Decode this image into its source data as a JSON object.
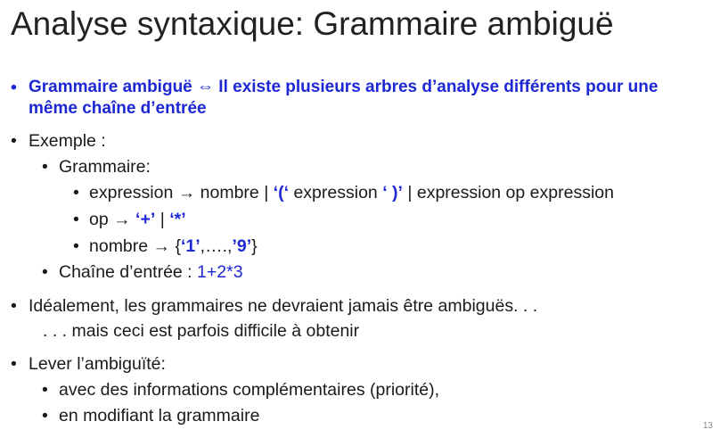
{
  "slide": {
    "title": "Analyse syntaxique: Grammaire ambiguë",
    "page_number": "13",
    "accent_color": "#1d28d4",
    "definition": {
      "line1": "Grammaire ambiguë ⇔ Il existe plusieurs arbres d’analyse différents pour une",
      "line2": "même chaîne d’entrée"
    },
    "example": {
      "label": "Exemple :",
      "grammar_label": "Grammaire:",
      "rule_expression": {
        "lhs": "expression",
        "arrow": "→",
        "alt1": "nombre |",
        "open_paren": "‘(‘",
        "mid": "expression",
        "close_paren": "‘ )’",
        "alt3": "| expression op expression"
      },
      "rule_op": {
        "lhs": "op",
        "arrow": "→",
        "plus": "‘+’",
        "sep": "|",
        "times": "‘*’"
      },
      "rule_nombre": {
        "lhs": "nombre",
        "arrow": "→",
        "open_brace": "{",
        "first": "‘1’",
        "dots": ",….,",
        "last": "’9’",
        "close_brace": "}"
      },
      "input_label": "Chaîne d’entrée :",
      "input_value": "1+2*3"
    },
    "ideal": {
      "line1": "Idéalement, les grammaires ne devraient jamais être ambiguës. . .",
      "line2": ". . . mais ceci est parfois difficile à obtenir"
    },
    "lever": {
      "label": "Lever l’ambiguïté:",
      "items": [
        "avec des informations complémentaires (priorité),",
        "en modifiant la grammaire"
      ]
    }
  }
}
